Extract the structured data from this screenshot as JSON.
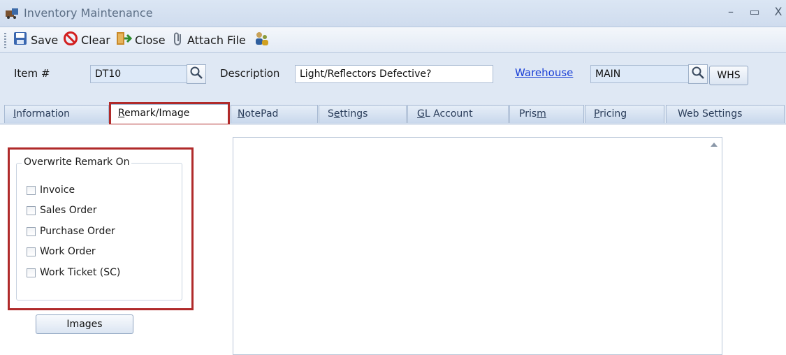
{
  "window": {
    "title": "Inventory Maintenance",
    "minimize": "–",
    "maximize": "▭",
    "close": "X"
  },
  "toolbar": {
    "save_label": "Save",
    "clear_label": "Clear",
    "close_label": "Close",
    "attach_label": "Attach File"
  },
  "header": {
    "item_label": "Item #",
    "item_value": "DT10",
    "description_label": "Description",
    "description_value": "Light/Reflectors Defective?",
    "warehouse_link": "Warehouse",
    "warehouse_value": "MAIN",
    "whs_button": "WHS"
  },
  "tabs": [
    {
      "label": "Information",
      "accel": "I",
      "rest": "nformation"
    },
    {
      "label": "Remark/Image",
      "accel": "R",
      "rest": "emark/Image"
    },
    {
      "label": "NotePad",
      "accel": "N",
      "rest": "otePad"
    },
    {
      "label": "Settings",
      "pre": "S",
      "accel": "e",
      "rest": "ttings"
    },
    {
      "label": "GL Account",
      "accel": "G",
      "rest": "L Account"
    },
    {
      "label": "Prism",
      "pre": "Pris",
      "accel": "m",
      "rest": ""
    },
    {
      "label": "Pricing",
      "accel": "P",
      "rest": "ricing"
    },
    {
      "label": "Web Settings",
      "accel": "",
      "rest": "Web Settings"
    }
  ],
  "remark": {
    "group_title": "Overwrite Remark On",
    "options": [
      {
        "label": "Invoice",
        "checked": false
      },
      {
        "label": "Sales Order",
        "checked": false
      },
      {
        "label": "Purchase Order",
        "checked": false
      },
      {
        "label": "Work Order",
        "checked": false
      },
      {
        "label": "Work Ticket (SC)",
        "checked": false
      }
    ],
    "images_button": "Images",
    "text_value": ""
  },
  "colors": {
    "highlight": "#b02a2a",
    "link": "#1a3fd6",
    "field_fill": "#dde9f8"
  },
  "icons": [
    "app-icon",
    "save-icon",
    "clear-icon",
    "close-door-icon",
    "paperclip-icon",
    "users-icon",
    "magnifier-icon",
    "scroll-up-arrow-icon"
  ]
}
